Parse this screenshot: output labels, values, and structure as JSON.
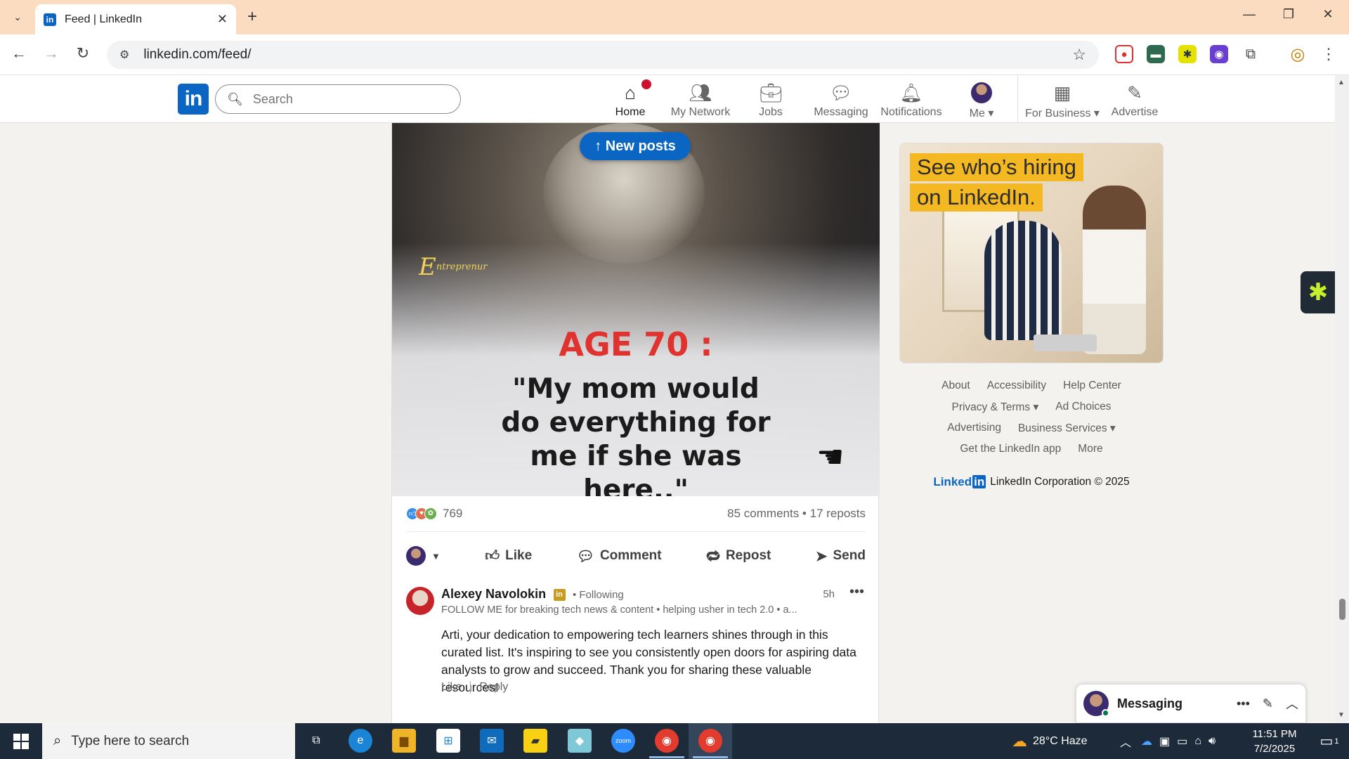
{
  "browser": {
    "tab_title": "Feed | LinkedIn",
    "url": "linkedin.com/feed/"
  },
  "linkedin": {
    "search_placeholder": "Search",
    "nav": [
      {
        "label": "Home",
        "icon": "home-icon",
        "active": true,
        "has_badge": true
      },
      {
        "label": "My Network",
        "icon": "network-icon"
      },
      {
        "label": "Jobs",
        "icon": "briefcase-icon"
      },
      {
        "label": "Messaging",
        "icon": "chat-icon"
      },
      {
        "label": "Notifications",
        "icon": "bell-icon"
      },
      {
        "label": "Me",
        "icon": "avatar"
      },
      {
        "label": "For Business",
        "icon": "grid-icon"
      },
      {
        "label": "Advertise",
        "icon": "compass-icon"
      }
    ],
    "accent_color": "#0a66c2"
  },
  "post": {
    "new_posts_label": "New posts",
    "image": {
      "brand_text": "ntreprenur",
      "brand_initial": "E",
      "headline": "AGE 70 :",
      "quote": "\"My mom would do everything for me if she was here..\""
    },
    "reaction_count": "769",
    "comments_reposts": "85 comments • 17 reposts",
    "actions": {
      "like": "Like",
      "comment": "Comment",
      "repost": "Repost",
      "send": "Send"
    },
    "comment": {
      "author": "Alexey Navolokin",
      "badge": "in",
      "following": "• Following",
      "time": "5h",
      "headline": "FOLLOW ME for breaking tech news & content • helping usher in tech 2.0 • a...",
      "text": "Arti, your dedication to empowering tech learners shines through in this curated list. It's inspiring to see you consistently open doors for aspiring data analysts to grow and succeed. Thank you for sharing these valuable resources!",
      "like": "Like",
      "reply": "Reply"
    }
  },
  "right_rail": {
    "ad_line1": "See who’s hiring",
    "ad_line2": "on LinkedIn.",
    "footer_rows": [
      [
        "About",
        "Accessibility",
        "Help Center"
      ],
      [
        "Privacy & Terms ▾",
        "Ad Choices"
      ],
      [
        "Advertising",
        "Business Services ▾"
      ],
      [
        "Get the LinkedIn app",
        "More"
      ]
    ],
    "footer_brand": "Linked",
    "footer_brand_in": "in",
    "copyright": "LinkedIn Corporation © 2025"
  },
  "messaging": {
    "label": "Messaging"
  },
  "taskbar": {
    "search_placeholder": "Type here to search",
    "weather": "28°C  Haze",
    "time": "11:51 PM",
    "date": "7/2/2025",
    "notification_count": "1"
  }
}
